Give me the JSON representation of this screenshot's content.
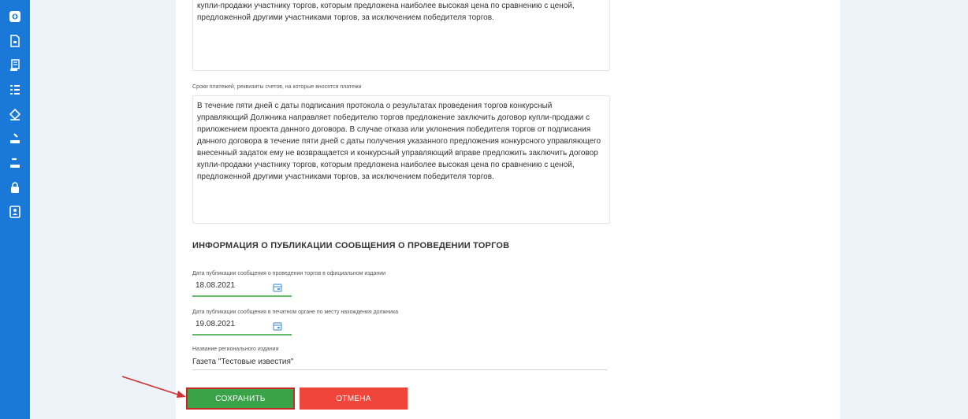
{
  "sidebar": {
    "icons": [
      "dashboard-icon",
      "document-icon",
      "report-icon",
      "list-icon",
      "scales-icon",
      "auction-icon",
      "auction-alt-icon",
      "lock-icon",
      "contacts-icon"
    ]
  },
  "top_textarea": {
    "lines": [
      "купли-продажи участнику торгов, которым предложена наиболее высокая цена по сравнению с ценой,",
      "предложенной другими участниками торгов, за исключением победителя торгов."
    ]
  },
  "payment": {
    "label": "Сроки платежей, реквизиты счетов, на которые вносятся платежи",
    "lines": [
      "В течение пяти дней с даты подписания протокола о результатах проведения торгов конкурсный",
      "управляющий Должника направляет победителю торгов предложение заключить договор купли-продажи с",
      "приложением проекта данного договора. В случае отказа или уклонения победителя торгов от подписания",
      "данного договора в течение пяти дней с даты получения указанного предложения конкурсного управляющего",
      "внесенный задаток ему не возвращается и конкурсный управляющий вправе предложить заключить договор",
      "купли-продажи участнику торгов, которым предложена наиболее высокая цена по сравнению с ценой,",
      "предложенной другими участниками торгов, за исключением победителя торгов."
    ]
  },
  "publication": {
    "title": "ИНФОРМАЦИЯ О ПУБЛИКАЦИИ СООБЩЕНИЯ О ПРОВЕДЕНИИ ТОРГОВ",
    "official_label": "Дата публикации сообщения о проведении торгов в официальном издании",
    "official_date": "18.08.2021",
    "print_label": "Дата публикации сообщения в печатном органе по месту нахождения должника",
    "print_date": "19.08.2021",
    "regional_label": "Название регионального издания",
    "regional_value": "Газета \"Тестовые известия\""
  },
  "actions": {
    "save": "СОХРАНИТЬ",
    "cancel": "ОТМЕНА"
  },
  "colors": {
    "sidebar": "#1a79d8",
    "save": "#3aa34a",
    "cancel": "#f0453a",
    "highlight": "#c62828",
    "field_underline": "#66bb6a"
  }
}
